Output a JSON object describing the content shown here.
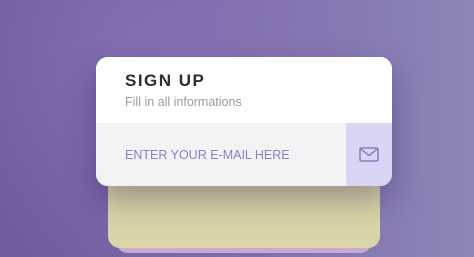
{
  "signup": {
    "title": "SIGN UP",
    "subtitle": "Fill in all informations",
    "email_placeholder": "ENTER YOUR E-MAIL HERE",
    "email_value": "",
    "submit_icon": "envelope-icon"
  },
  "colors": {
    "background_left": "#6f5c9e",
    "background_right": "#8d86b8",
    "card": "#ffffff",
    "input_background": "#f3f2f5",
    "accent_text": "#8a7fc0",
    "submit_background": "#d9d6f5",
    "stack_layer_yellow": "#d9d5a6",
    "stack_layer_pink": "#c9a9d3"
  }
}
